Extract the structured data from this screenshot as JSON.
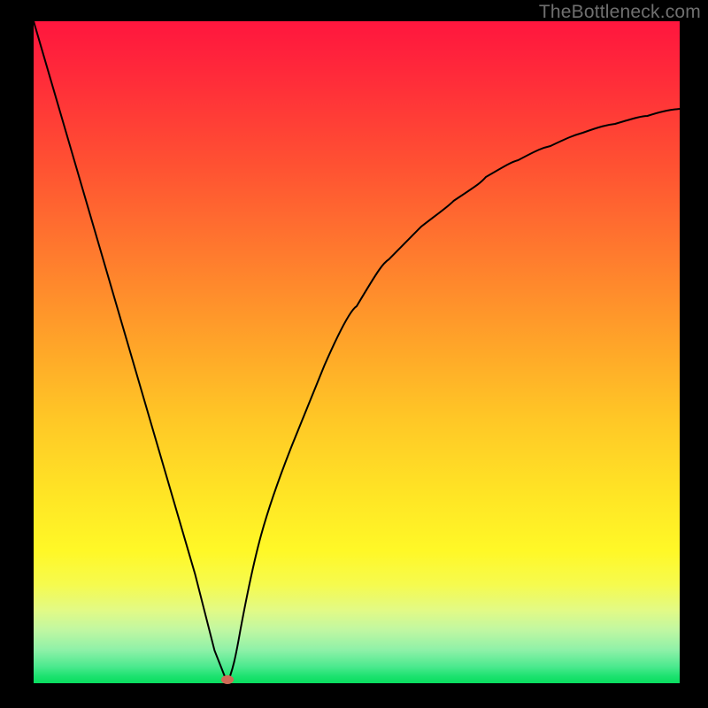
{
  "watermark": "TheBottleneck.com",
  "colors": {
    "frame": "#000000",
    "curve": "#000000",
    "marker": "#d06a56",
    "gradient_top": "#ff163e",
    "gradient_bottom": "#09dd5f"
  },
  "chart_data": {
    "type": "line",
    "title": "",
    "xlabel": "",
    "ylabel": "",
    "xlim": [
      0,
      100
    ],
    "ylim": [
      0,
      100
    ],
    "series": [
      {
        "name": "left-branch",
        "x": [
          0,
          5,
          10,
          15,
          20,
          25,
          28,
          30
        ],
        "values": [
          100,
          83,
          66,
          50,
          33,
          16,
          5,
          0
        ]
      },
      {
        "name": "right-branch",
        "x": [
          30,
          32,
          35,
          40,
          45,
          50,
          55,
          60,
          65,
          70,
          75,
          80,
          85,
          90,
          95,
          100
        ],
        "values": [
          0,
          8,
          20,
          36,
          48,
          57,
          64,
          69,
          73,
          76.5,
          79,
          81.2,
          83,
          84.5,
          85.7,
          86.8
        ]
      }
    ],
    "minimum_marker": {
      "x": 30,
      "y": 0
    },
    "annotations": [
      {
        "text": "TheBottleneck.com",
        "position": "top-right"
      }
    ]
  }
}
